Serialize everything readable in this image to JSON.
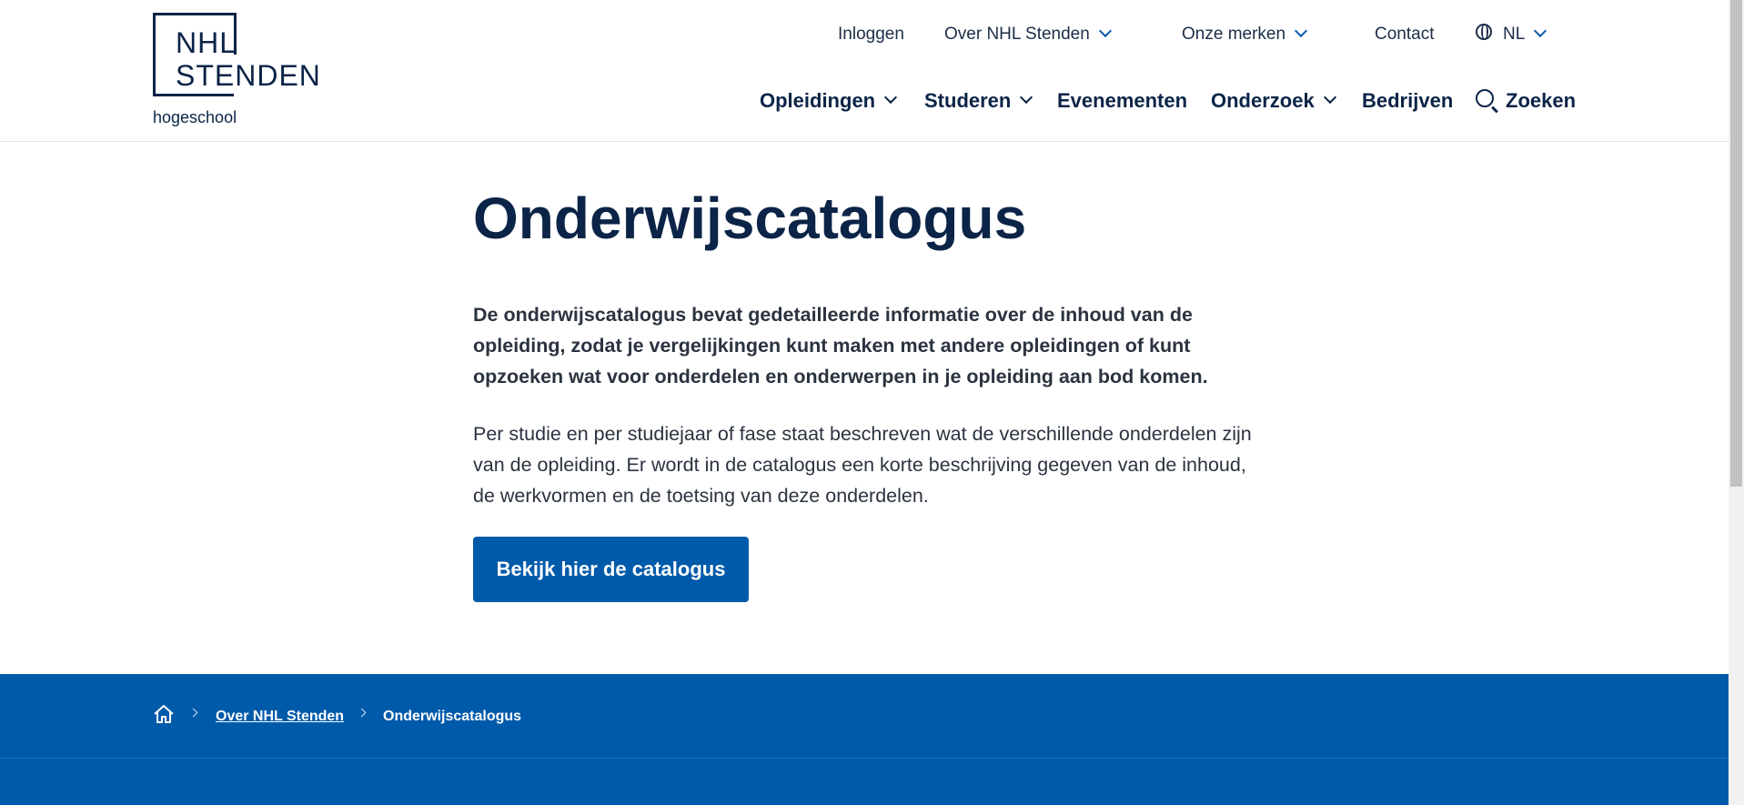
{
  "logo": {
    "line1": "NHL",
    "line2": "STENDEN",
    "sub": "hogeschool"
  },
  "topnav": {
    "login": "Inloggen",
    "about": "Over NHL Stenden",
    "brands": "Onze merken",
    "contact": "Contact",
    "language": "NL"
  },
  "mainnav": {
    "opleidingen": "Opleidingen",
    "studeren": "Studeren",
    "evenementen": "Evenementen",
    "onderzoek": "Onderzoek",
    "bedrijven": "Bedrijven",
    "zoeken": "Zoeken"
  },
  "content": {
    "title": "Onderwijscatalogus",
    "paragraph1": "De onderwijscatalogus bevat gedetailleerde informatie over de inhoud van de opleiding, zodat je vergelijkingen kunt maken met andere opleidingen of kunt opzoeken wat voor onderdelen en onderwerpen in je opleiding aan bod komen.",
    "paragraph2": "Per studie en per studiejaar of fase staat beschreven wat de verschillende onderdelen zijn van de opleiding. Er wordt in de catalogus een korte beschrijving gegeven van de inhoud, de werkvormen en de toetsing van deze onderdelen.",
    "cta": "Bekijk hier de catalogus"
  },
  "breadcrumb": {
    "items": [
      "Over NHL Stenden",
      "Onderwijscatalogus"
    ]
  },
  "colors": {
    "brand_blue": "#005aaa",
    "navy": "#0b2447"
  }
}
